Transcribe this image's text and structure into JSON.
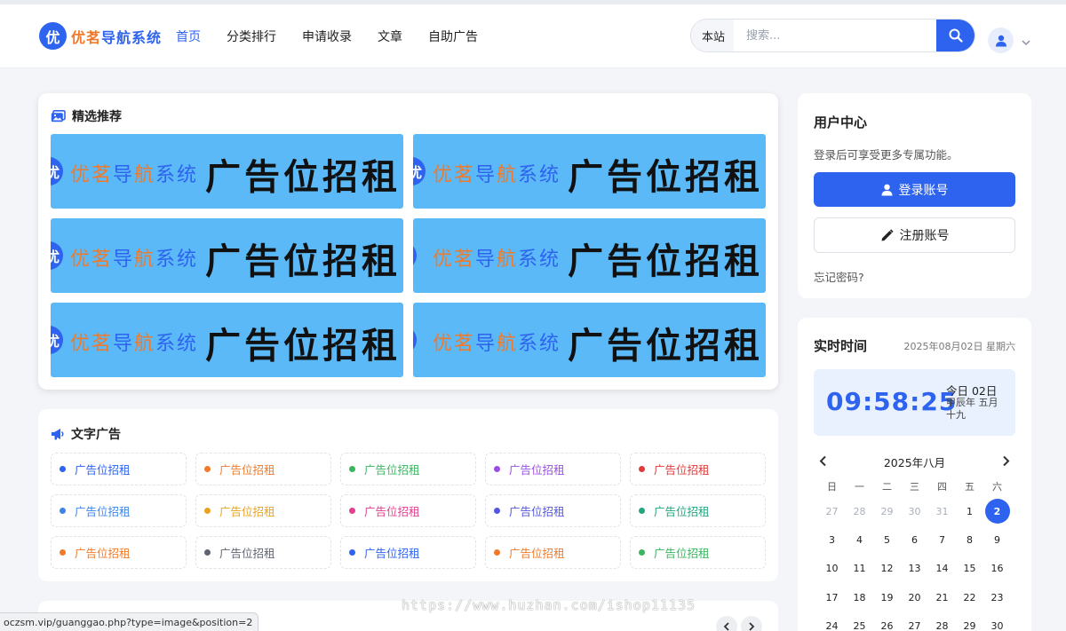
{
  "header": {
    "logo_badge": "优",
    "logo_part1": "优茗",
    "logo_part2": "导航系统",
    "nav": [
      "首页",
      "分类排行",
      "申请收录",
      "文章",
      "自助广告"
    ],
    "search_scope": "本站",
    "search_placeholder": "搜索...",
    "search_value": ""
  },
  "featured": {
    "title": "精选推荐",
    "banners": [
      {
        "brand1": "优茗",
        "brand2": "导",
        "brand3": "航",
        "brand4": "系统",
        "text": "广告位招租"
      },
      {
        "brand1": "优茗",
        "brand2": "导",
        "brand3": "航",
        "brand4": "系统",
        "text": "广告位招租"
      },
      {
        "brand1": "优茗",
        "brand2": "导",
        "brand3": "航",
        "brand4": "系统",
        "text": "广告位招租"
      },
      {
        "brand1": "优茗",
        "brand2": "导",
        "brand3": "航",
        "brand4": "系统",
        "text": "广告位招租"
      },
      {
        "brand1": "优茗",
        "brand2": "导",
        "brand3": "航",
        "brand4": "系统",
        "text": "广告位招租"
      },
      {
        "brand1": "优茗",
        "brand2": "导",
        "brand3": "航",
        "brand4": "系统",
        "text": "广告位招租"
      }
    ]
  },
  "text_ads": {
    "title": "文字广告",
    "items": [
      {
        "label": "广告位招租",
        "color": "#2d63ee"
      },
      {
        "label": "广告位招租",
        "color": "#f07a2a"
      },
      {
        "label": "广告位招租",
        "color": "#3bb560"
      },
      {
        "label": "广告位招租",
        "color": "#9b4ee6"
      },
      {
        "label": "广告位招租",
        "color": "#e03b3b"
      },
      {
        "label": "广告位招租",
        "color": "#3d86e8"
      },
      {
        "label": "广告位招租",
        "color": "#e9a21d"
      },
      {
        "label": "广告位招租",
        "color": "#e2408e"
      },
      {
        "label": "广告位招租",
        "color": "#5356e0"
      },
      {
        "label": "广告位招租",
        "color": "#25a57f"
      },
      {
        "label": "广告位招租",
        "color": "#f07a2a"
      },
      {
        "label": "广告位招租",
        "color": "#5e6470"
      },
      {
        "label": "广告位招租",
        "color": "#2d63ee"
      },
      {
        "label": "广告位招租",
        "color": "#f07a2a"
      },
      {
        "label": "广告位招租",
        "color": "#3bb560"
      }
    ]
  },
  "user_center": {
    "title": "用户中心",
    "desc": "登录后可享受更多专属功能。",
    "login": "登录账号",
    "register": "注册账号",
    "forgot": "忘记密码?"
  },
  "realtime": {
    "title": "实时时间",
    "date": "2025年08月02日 星期六",
    "clock": "09:58:25",
    "today": "今日 02日",
    "lunar": "甲辰年 五月十九",
    "month": "2025年八月",
    "weekdays": [
      "日",
      "一",
      "二",
      "三",
      "四",
      "五",
      "六"
    ],
    "days": [
      {
        "d": "27",
        "m": true
      },
      {
        "d": "28",
        "m": true
      },
      {
        "d": "29",
        "m": true
      },
      {
        "d": "30",
        "m": true
      },
      {
        "d": "31",
        "m": true
      },
      {
        "d": "1"
      },
      {
        "d": "2",
        "today": true
      },
      {
        "d": "3"
      },
      {
        "d": "4"
      },
      {
        "d": "5"
      },
      {
        "d": "6"
      },
      {
        "d": "7"
      },
      {
        "d": "8"
      },
      {
        "d": "9"
      },
      {
        "d": "10"
      },
      {
        "d": "11"
      },
      {
        "d": "12"
      },
      {
        "d": "13"
      },
      {
        "d": "14"
      },
      {
        "d": "15"
      },
      {
        "d": "16"
      },
      {
        "d": "17"
      },
      {
        "d": "18"
      },
      {
        "d": "19"
      },
      {
        "d": "20"
      },
      {
        "d": "21"
      },
      {
        "d": "22"
      },
      {
        "d": "23"
      },
      {
        "d": "24"
      },
      {
        "d": "25"
      },
      {
        "d": "26"
      },
      {
        "d": "27"
      },
      {
        "d": "28"
      },
      {
        "d": "29"
      },
      {
        "d": "30"
      }
    ]
  },
  "status_url": "oczsm.vip/guanggao.php?type=image&position=2",
  "watermark": "https://www.huzhan.com/ishop11135",
  "colors": {
    "accent": "#2d63ee",
    "orange": "#f07a2a",
    "banner_bg": "#5bb9f7"
  }
}
